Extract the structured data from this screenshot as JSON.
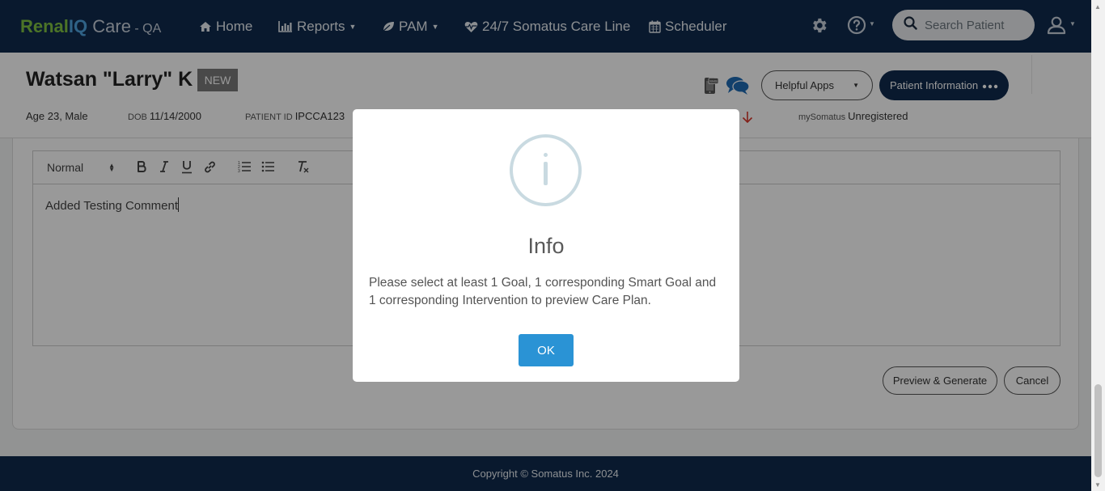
{
  "navbar": {
    "brand": {
      "renal": "Renal",
      "iq": "IQ",
      "care": " Care",
      "env": " - QA"
    },
    "items": [
      {
        "label": "Home",
        "icon": "home-icon"
      },
      {
        "label": "Reports",
        "icon": "bar-chart-icon",
        "dropdown": true
      },
      {
        "label": "PAM",
        "icon": "leaf-icon",
        "dropdown": true
      },
      {
        "label": "24/7 Somatus Care Line",
        "icon": "heartbeat-icon"
      },
      {
        "label": "Scheduler",
        "icon": "calendar-icon"
      }
    ],
    "search_placeholder": "Search Patient"
  },
  "patient": {
    "name": "Watsan \"Larry\" K",
    "badge": "NEW",
    "age_sex": "Age 23, Male",
    "dob_label": "DOB",
    "dob": "11/14/2000",
    "id_label": "PATIENT ID",
    "id": "IPCCA123",
    "mysomatus_label": "mySomatus",
    "mysomatus_status": "Unregistered",
    "helpful_apps": "Helpful Apps",
    "patient_info": "Patient Information"
  },
  "editor": {
    "format": "Normal",
    "content": "Added Testing Comment"
  },
  "actions": {
    "preview": "Preview & Generate",
    "cancel": "Cancel"
  },
  "footer": {
    "copyright": "Copyright © Somatus Inc. 2024"
  },
  "modal": {
    "icon": "info-icon",
    "title": "Info",
    "message": "Please select at least 1 Goal, 1 corresponding Smart Goal and 1 corresponding Intervention to preview Care Plan.",
    "ok": "OK"
  },
  "colors": {
    "navbar_bg": "#0f2a4d",
    "brand_green": "#7fc242",
    "brand_blue": "#4fa3df",
    "ok_button": "#2a93d5",
    "alert_red": "#d9362b"
  }
}
